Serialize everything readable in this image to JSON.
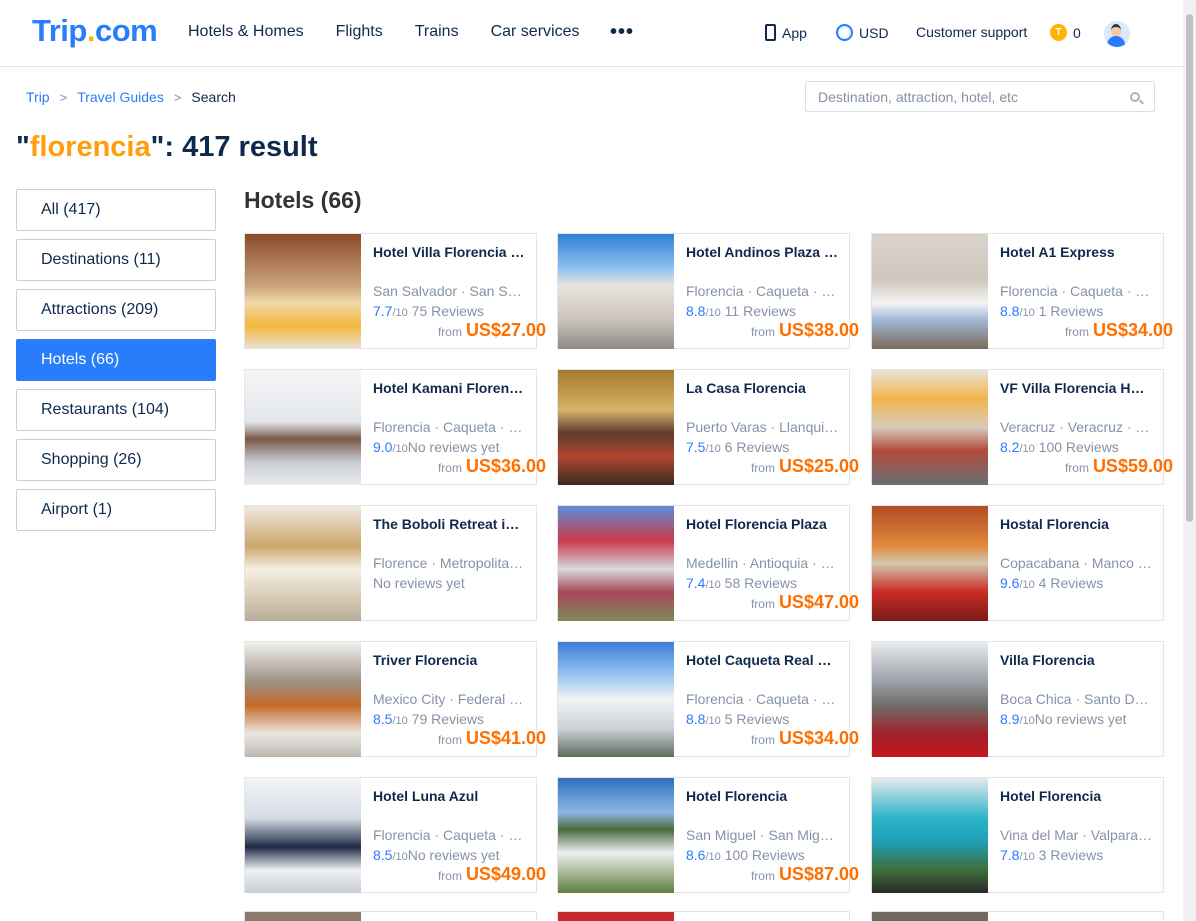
{
  "header": {
    "logo_main": "Trip",
    "logo_dot": ".",
    "logo_tld": "com",
    "nav": [
      "Hotels & Homes",
      "Flights",
      "Trains",
      "Car services"
    ],
    "more": "•••",
    "app_label": "App",
    "currency_label": "USD",
    "support_label": "Customer support",
    "coins_icon": "T",
    "coins_count": "0"
  },
  "breadcrumb": {
    "items": [
      "Trip",
      "Travel Guides"
    ],
    "current": "Search",
    "separator": ">"
  },
  "search": {
    "placeholder": "Destination, attraction, hotel, etc",
    "value": ""
  },
  "results": {
    "quote_open": "\"",
    "keyword": "florencia",
    "quote_close": "\"",
    "summary": ": 417 result"
  },
  "sidebar": {
    "items": [
      {
        "label": "All (417)",
        "active": false
      },
      {
        "label": "Destinations (11)",
        "active": false
      },
      {
        "label": "Attractions (209)",
        "active": false
      },
      {
        "label": "Hotels (66)",
        "active": true
      },
      {
        "label": "Restaurants (104)",
        "active": false
      },
      {
        "label": "Shopping (26)",
        "active": false
      },
      {
        "label": "Airport (1)",
        "active": false
      }
    ]
  },
  "section": {
    "title": "Hotels (66)"
  },
  "colors": {
    "brand_blue": "#287dfa",
    "keyword_orange": "#ff9d0a",
    "price_orange": "#ff6f00",
    "text_dark": "#0f294d",
    "text_muted": "#8592a6"
  },
  "hotels": [
    {
      "name": "Hotel Villa Florencia …",
      "location": "San Salvador · San S…",
      "score": "7.7",
      "outof": "/10",
      "reviews": " 75 Reviews",
      "from": "from",
      "price": "US$27.00",
      "thumb": "thumb-1"
    },
    {
      "name": "Hotel Andinos Plaza …",
      "location": "Florencia · Caqueta · …",
      "score": "8.8",
      "outof": "/10",
      "reviews": " 11 Reviews",
      "from": "from",
      "price": "US$38.00",
      "thumb": "thumb-2"
    },
    {
      "name": "Hotel A1 Express",
      "location": "Florencia · Caqueta · …",
      "score": "8.8",
      "outof": "/10",
      "reviews": " 1 Reviews",
      "from": "from",
      "price": "US$34.00",
      "thumb": "thumb-3"
    },
    {
      "name": "Hotel Kamani Floren…",
      "location": "Florencia · Caqueta · …",
      "score": "9.0",
      "outof": "/10",
      "reviews": "No reviews yet",
      "from": "from",
      "price": "US$36.00",
      "thumb": "thumb-4"
    },
    {
      "name": "La Casa Florencia",
      "location": "Puerto Varas · Llanqui…",
      "score": "7.5",
      "outof": "/10",
      "reviews": " 6 Reviews",
      "from": "from",
      "price": "US$25.00",
      "thumb": "thumb-5"
    },
    {
      "name": "VF Villa Florencia H…",
      "location": "Veracruz · Veracruz · …",
      "score": "8.2",
      "outof": "/10",
      "reviews": " 100 Reviews",
      "from": "from",
      "price": "US$59.00",
      "thumb": "thumb-6"
    },
    {
      "name": "The Boboli Retreat i…",
      "location": "Florence · Metropolita…",
      "score": "",
      "outof": "",
      "reviews": "No reviews yet",
      "from": "",
      "price": "",
      "thumb": "thumb-7"
    },
    {
      "name": "Hotel Florencia Plaza",
      "location": "Medellin · Antioquia · …",
      "score": "7.4",
      "outof": "/10",
      "reviews": " 58 Reviews",
      "from": "from",
      "price": "US$47.00",
      "thumb": "thumb-8"
    },
    {
      "name": "Hostal Florencia",
      "location": "Copacabana · Manco …",
      "score": "9.6",
      "outof": "/10",
      "reviews": " 4 Reviews",
      "from": "",
      "price": "",
      "thumb": "thumb-9"
    },
    {
      "name": "Triver Florencia",
      "location": "Mexico City · Federal …",
      "score": "8.5",
      "outof": "/10",
      "reviews": " 79 Reviews",
      "from": "from",
      "price": "US$41.00",
      "thumb": "thumb-10"
    },
    {
      "name": "Hotel Caqueta Real …",
      "location": "Florencia · Caqueta · …",
      "score": "8.8",
      "outof": "/10",
      "reviews": " 5 Reviews",
      "from": "from",
      "price": "US$34.00",
      "thumb": "thumb-11"
    },
    {
      "name": "Villa Florencia",
      "location": "Boca Chica · Santo D…",
      "score": "8.9",
      "outof": "/10",
      "reviews": "No reviews yet",
      "from": "",
      "price": "",
      "thumb": "thumb-12"
    },
    {
      "name": "Hotel Luna Azul",
      "location": "Florencia · Caqueta · …",
      "score": "8.5",
      "outof": "/10",
      "reviews": "No reviews yet",
      "from": "from",
      "price": "US$49.00",
      "thumb": "thumb-13"
    },
    {
      "name": "Hotel Florencia",
      "location": "San Miguel · San Mig…",
      "score": "8.6",
      "outof": "/10",
      "reviews": " 100 Reviews",
      "from": "from",
      "price": "US$87.00",
      "thumb": "thumb-14"
    },
    {
      "name": "Hotel Florencia",
      "location": "Vina del Mar · Valpara…",
      "score": "7.8",
      "outof": "/10",
      "reviews": " 3 Reviews",
      "from": "",
      "price": "",
      "thumb": "thumb-15"
    }
  ]
}
